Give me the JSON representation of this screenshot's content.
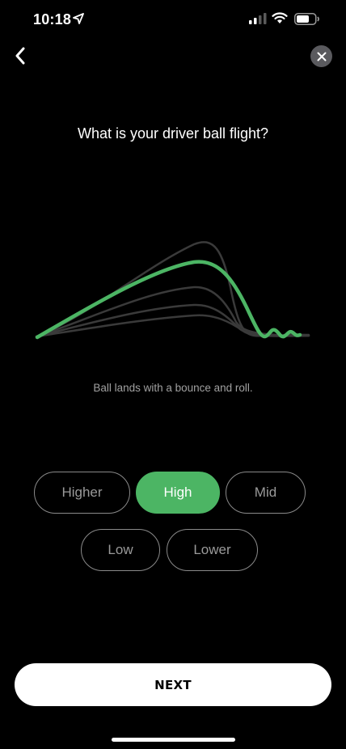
{
  "status_bar": {
    "time": "10:18"
  },
  "question": "What is your driver ball flight?",
  "caption": "Ball lands with a bounce and roll.",
  "options": [
    {
      "label": "Higher",
      "selected": false
    },
    {
      "label": "High",
      "selected": true
    },
    {
      "label": "Mid",
      "selected": false
    },
    {
      "label": "Low",
      "selected": false
    },
    {
      "label": "Lower",
      "selected": false
    }
  ],
  "next_label": "NEXT",
  "colors": {
    "accent": "#4cb564",
    "background": "#000000"
  },
  "icons": {
    "back": "chevron-left-icon",
    "close": "close-icon"
  }
}
